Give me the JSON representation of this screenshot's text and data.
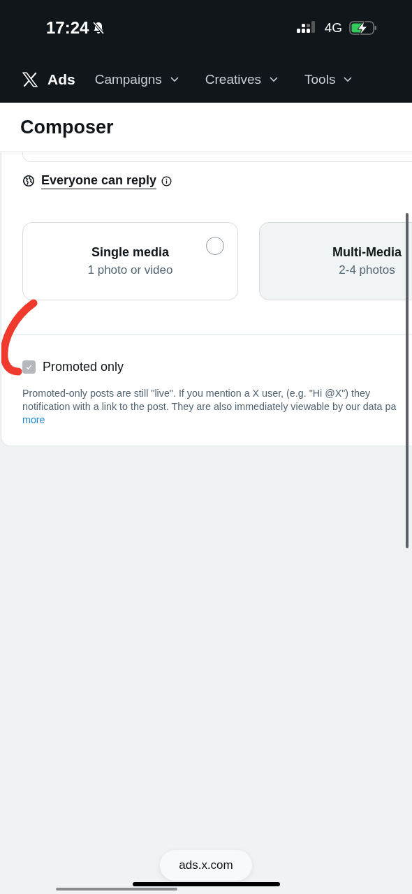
{
  "status_bar": {
    "time": "17:24",
    "network": "4G"
  },
  "nav": {
    "brand": "Ads",
    "menus": [
      {
        "label": "Campaigns"
      },
      {
        "label": "Creatives"
      },
      {
        "label": "Tools"
      }
    ]
  },
  "page_title": "Composer",
  "reply_setting": {
    "label": "Everyone can reply"
  },
  "media_options": [
    {
      "title": "Single media",
      "subtitle": "1 photo or video",
      "selected": false,
      "disabled": false
    },
    {
      "title": "Multi-Media",
      "subtitle": "2-4 photos",
      "disabled": true
    }
  ],
  "promoted_only": {
    "label": "Promoted only",
    "checked": true,
    "disabled": true,
    "description_lines": [
      "Promoted-only posts are still \"live\". If you mention a X user, (e.g. \"Hi @X\") they",
      "notification with a link to the post. They are also immediately viewable by our data pa"
    ],
    "link": "more"
  },
  "browser": {
    "url": "ads.x.com"
  }
}
